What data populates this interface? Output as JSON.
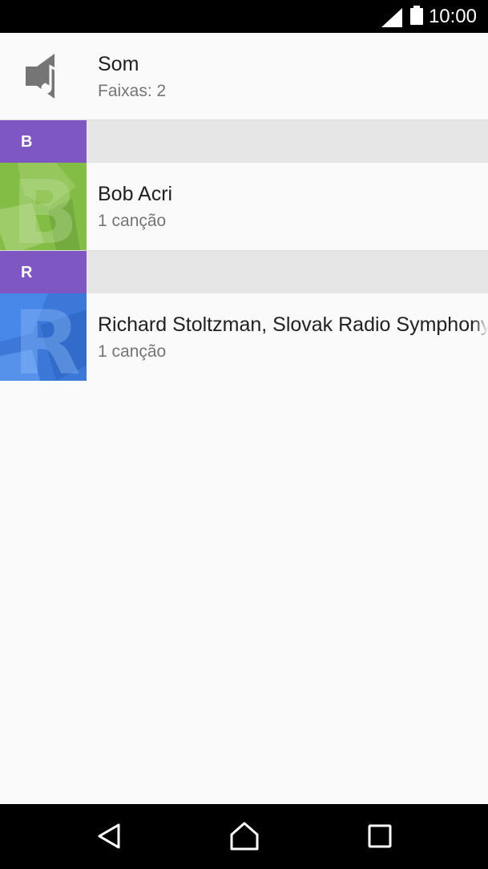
{
  "status_bar": {
    "time": "10:00",
    "icons": [
      "signal-icon",
      "battery-icon"
    ]
  },
  "header": {
    "icon": "speaker-music-icon",
    "title": "Som",
    "subtitle": "Faixas: 2"
  },
  "sections": [
    {
      "letter": "B",
      "artists": [
        {
          "name": "Bob Acri",
          "count": "1 canção",
          "thumb_color": "#8bc34a"
        }
      ]
    },
    {
      "letter": "R",
      "artists": [
        {
          "name": "Richard Stoltzman, Slovak Radio Symphony",
          "count": "1 canção",
          "thumb_color": "#3f7fe0"
        }
      ]
    }
  ],
  "colors": {
    "section_accent": "#7e57c2",
    "section_bg": "#e6e6e6",
    "background": "#fafafa"
  },
  "nav_bar": {
    "buttons": [
      "back-icon",
      "home-icon",
      "recents-icon"
    ]
  }
}
